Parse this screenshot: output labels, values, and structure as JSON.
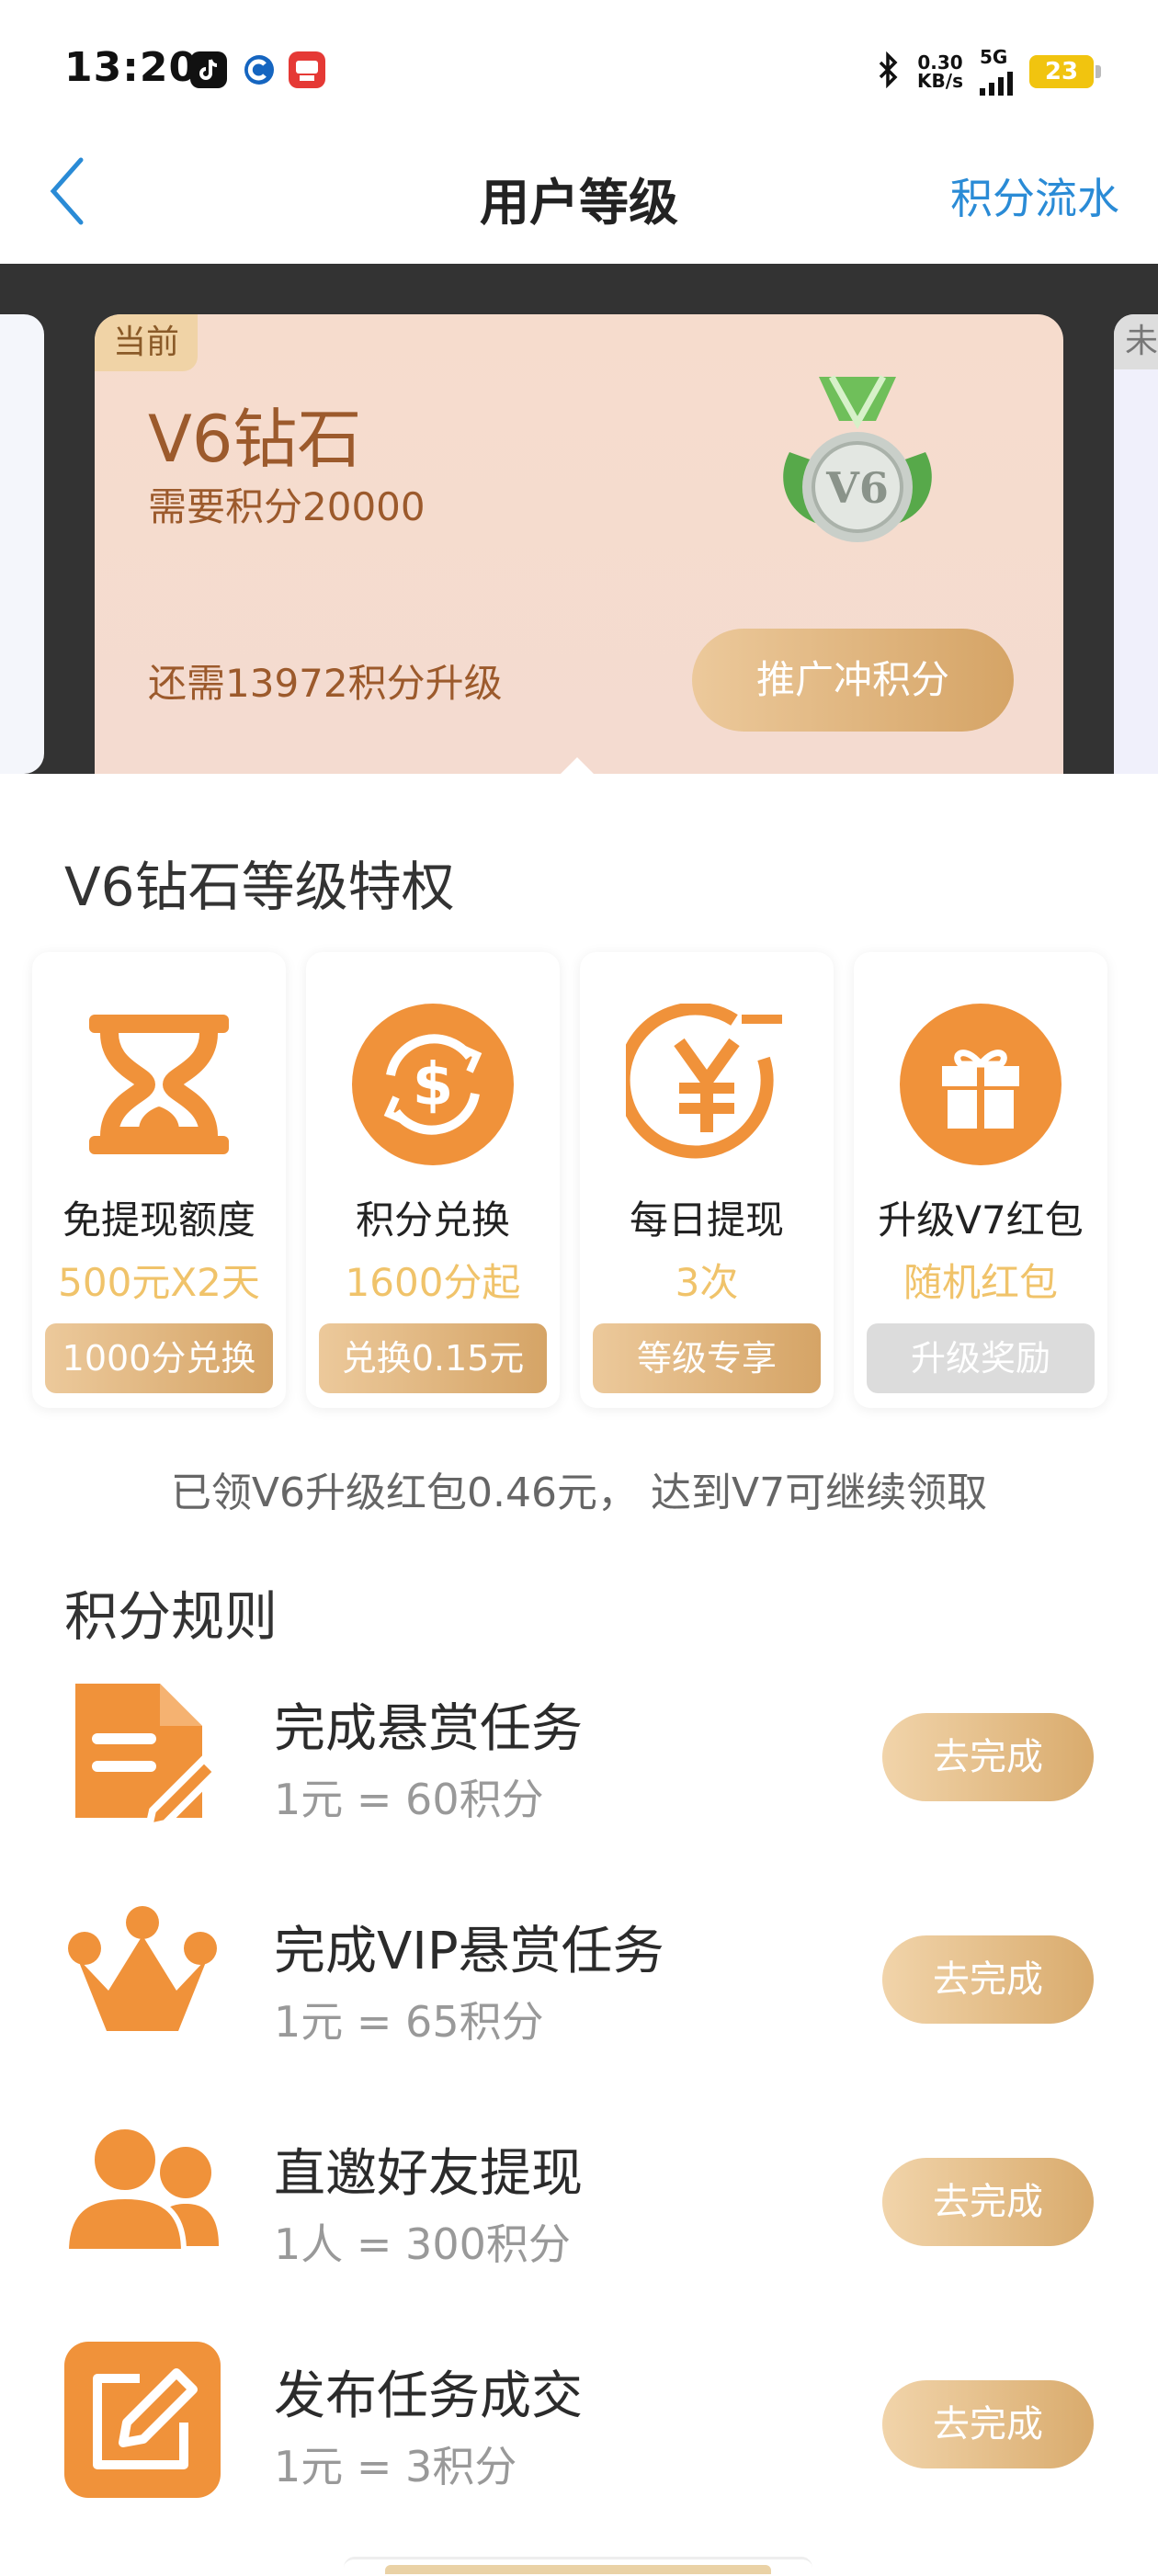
{
  "status_bar": {
    "time": "13:20",
    "net_speed_value": "0.30",
    "net_speed_unit": "KB/s",
    "signal": "5G",
    "battery": "23",
    "icons": [
      "tiktok-icon",
      "circle-app-icon",
      "news-app-icon",
      "bluetooth-icon"
    ]
  },
  "nav": {
    "title": "用户等级",
    "right_link": "积分流水",
    "back_icon": "chevron-left-icon",
    "accent_color": "#2a8bd6"
  },
  "level_card": {
    "right_tag": "未",
    "current_tag": "当前",
    "level_name": "V6钻石",
    "required": "需要积分20000",
    "medal_text": "V6",
    "remaining": "还需13972积分升级",
    "button": "推广冲积分"
  },
  "privileges": {
    "title": "V6钻石等级特权",
    "items": [
      {
        "icon": "hourglass-icon",
        "name": "免提现额度",
        "value": "500元X2天",
        "button": "1000分兑换"
      },
      {
        "icon": "dollar-exchange-icon",
        "name": "积分兑换",
        "value": "1600分起",
        "button": "兑换0.15元"
      },
      {
        "icon": "yen-circle-icon",
        "name": "每日提现",
        "value": "3次",
        "button": "等级专享"
      },
      {
        "icon": "gift-icon",
        "name": "升级V7红包",
        "value": "随机红包",
        "button": "升级奖励"
      }
    ]
  },
  "notice": "已领V6升级红包0.46元， 达到V7可继续领取",
  "rules": {
    "title": "积分规则",
    "items": [
      {
        "icon": "document-edit-icon",
        "title": "完成悬赏任务",
        "subtitle": "1元 = 60积分",
        "button": "去完成"
      },
      {
        "icon": "crown-icon",
        "title": "完成VIP悬赏任务",
        "subtitle": "1元 = 65积分",
        "button": "去完成"
      },
      {
        "icon": "users-icon",
        "title": "直邀好友提现",
        "subtitle": "1人 = 300积分",
        "button": "去完成"
      },
      {
        "icon": "edit-square-icon",
        "title": "发布任务成交",
        "subtitle": "1元 = 3积分",
        "button": "去完成"
      }
    ]
  },
  "colors": {
    "orange": "#f0923a",
    "gold": "#d5a466",
    "banner_bg": "#333333"
  }
}
